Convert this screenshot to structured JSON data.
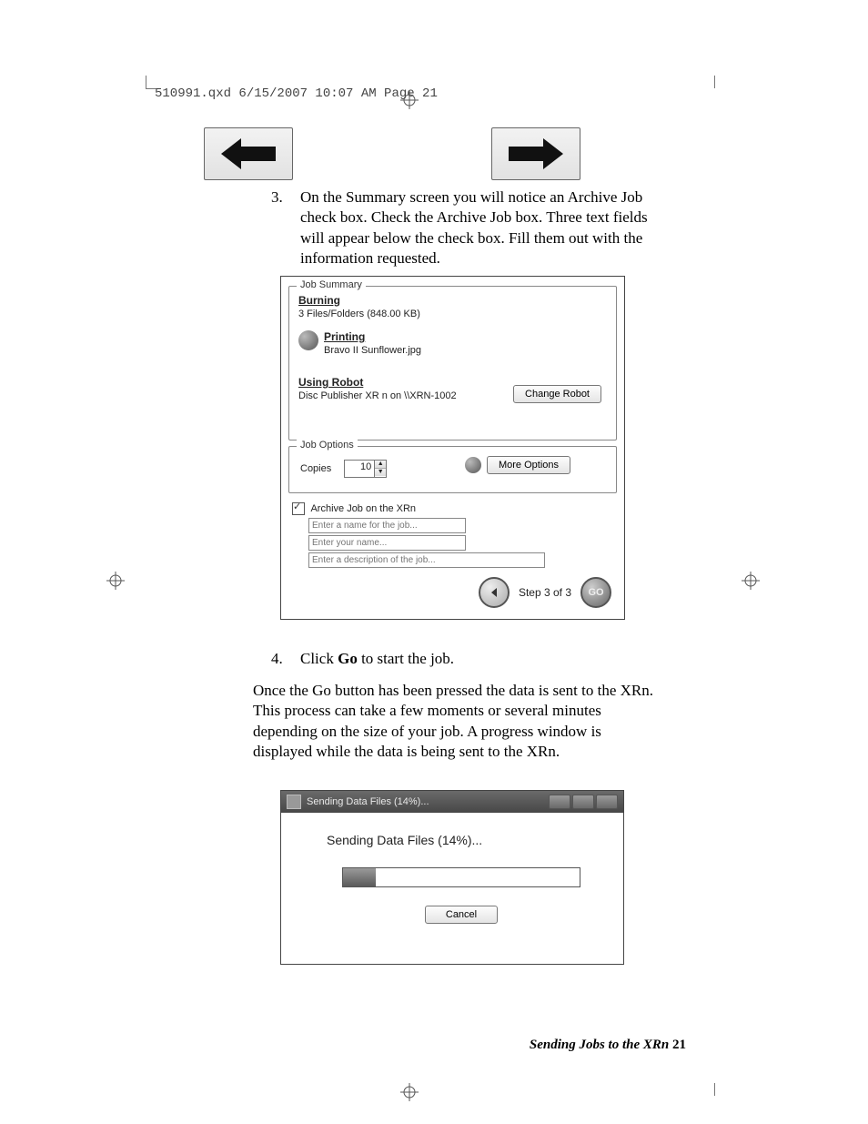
{
  "slug": "510991.qxd  6/15/2007  10:07 AM  Page 21",
  "step3": {
    "num": "3.",
    "text": "On the Summary screen you will notice an Archive Job check box. Check the Archive Job box.  Three text fields will appear below the check box.  Fill them out with the information requested."
  },
  "shot1": {
    "jobSummary": {
      "legend": "Job Summary",
      "burning": {
        "label": "Burning",
        "detail": "3 Files/Folders (848.00 KB)"
      },
      "printing": {
        "label": "Printing",
        "detail": "Bravo II Sunflower.jpg"
      },
      "robot": {
        "label": "Using Robot",
        "detail": "Disc Publisher XR n  on  \\\\XRN-1002",
        "button": "Change Robot"
      }
    },
    "jobOptions": {
      "legend": "Job Options",
      "copiesLabel": "Copies",
      "copiesValue": "10",
      "moreBtn": "More Options"
    },
    "archive": {
      "chkLabel": "Archive Job on the XRn",
      "field1": "Enter a name for the job...",
      "field2": "Enter your name...",
      "field3": "Enter a description of the job..."
    },
    "nav": {
      "step": "Step 3 of 3",
      "go": "GO"
    }
  },
  "step4": {
    "num": "4.",
    "text_a": "Click ",
    "text_bold": "Go",
    "text_b": " to start the job."
  },
  "para": "Once the Go button has been pressed the data is sent to the XRn.  This process can take a few moments or several minutes depending on the size of your job.  A progress window is displayed while the data is being sent to the XRn.",
  "shot2": {
    "title": "Sending Data Files (14%)...",
    "heading": "Sending Data Files (14%)...",
    "cancel": "Cancel"
  },
  "footer": {
    "text": "Sending Jobs to the XRn",
    "page": "21"
  }
}
